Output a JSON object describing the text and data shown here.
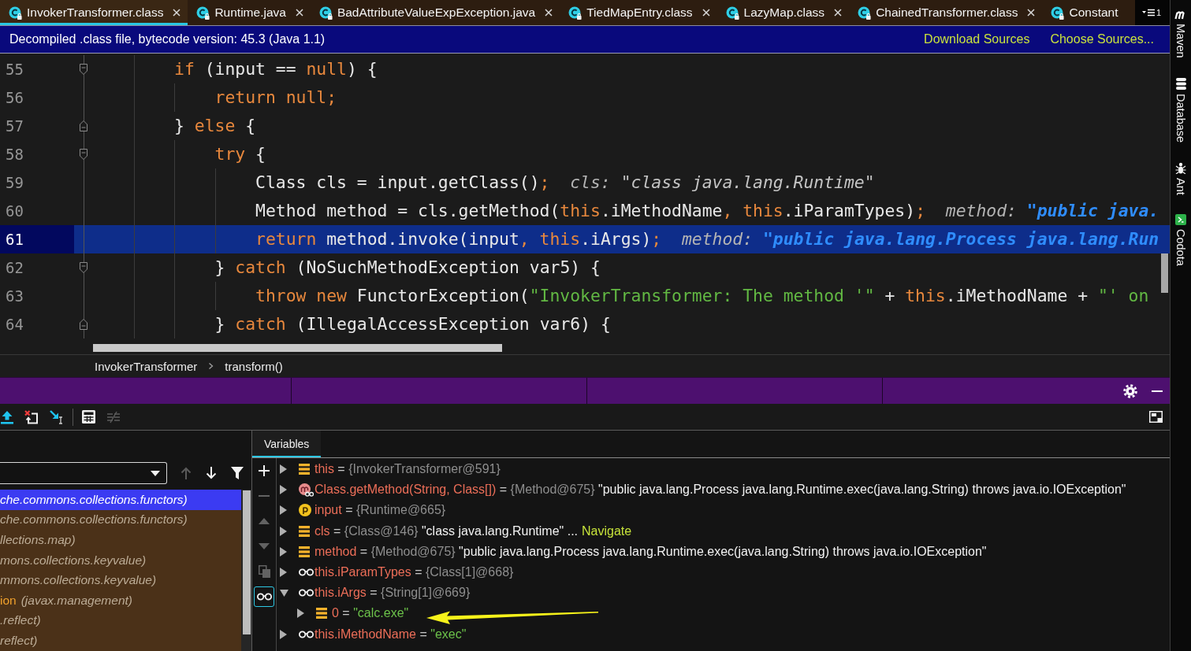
{
  "tabs": [
    {
      "label": "InvokerTransformer.class",
      "selected": true,
      "closable": true
    },
    {
      "label": "Runtime.java",
      "selected": false,
      "closable": true
    },
    {
      "label": "BadAttributeValueExpException.java",
      "selected": false,
      "closable": true
    },
    {
      "label": "TiedMapEntry.class",
      "selected": false,
      "closable": true
    },
    {
      "label": "LazyMap.class",
      "selected": false,
      "closable": true
    },
    {
      "label": "ChainedTransformer.class",
      "selected": false,
      "closable": true
    },
    {
      "label": "Constant",
      "selected": false,
      "closable": false
    }
  ],
  "hidden_tabs": {
    "count": "1"
  },
  "banner": {
    "message": "Decompiled .class file, bytecode version: 45.3 (Java 1.1)",
    "links": [
      "Download Sources",
      "Choose Sources..."
    ]
  },
  "editor": {
    "lines": [
      {
        "number": "55",
        "fold": {
          "kind": "start"
        },
        "current": false,
        "tokens": [
          {
            "kind": "keyword",
            "text": "        if"
          },
          {
            "kind": "plain",
            "text": " (input == "
          },
          {
            "kind": "keyword",
            "text": "null"
          },
          {
            "kind": "plain",
            "text": ") {"
          }
        ]
      },
      {
        "number": "56",
        "current": false,
        "tokens": [
          {
            "kind": "keyword",
            "text": "            return null;"
          }
        ]
      },
      {
        "number": "57",
        "fold": {
          "kind": "end"
        },
        "current": false,
        "tokens": [
          {
            "kind": "plain",
            "text": "        } "
          },
          {
            "kind": "keyword",
            "text": "else"
          },
          {
            "kind": "plain",
            "text": " {"
          }
        ]
      },
      {
        "number": "58",
        "fold": {
          "kind": "start"
        },
        "current": false,
        "tokens": [
          {
            "kind": "keyword",
            "text": "            try"
          },
          {
            "kind": "plain",
            "text": " {"
          }
        ]
      },
      {
        "number": "59",
        "current": false,
        "tokens": [
          {
            "kind": "plain",
            "text": "                Class cls = input.getClass()"
          },
          {
            "kind": "keyword",
            "text": ";"
          }
        ],
        "inline": {
          "name": "cls:",
          "value": "\"class java.lang.Runtime\"",
          "changed": false
        }
      },
      {
        "number": "60",
        "current": false,
        "tokens": [
          {
            "kind": "plain",
            "text": "                Method method = cls.getMethod("
          },
          {
            "kind": "keyword",
            "text": "this"
          },
          {
            "kind": "plain",
            "text": ".iMethodName"
          },
          {
            "kind": "keyword",
            "text": ", this"
          },
          {
            "kind": "plain",
            "text": ".iParamTypes)"
          },
          {
            "kind": "keyword",
            "text": ";"
          }
        ],
        "inline": {
          "name": "method:",
          "value": "\"public java.",
          "changed": true
        }
      },
      {
        "number": "61",
        "current": true,
        "tokens": [
          {
            "kind": "keyword",
            "text": "                return"
          },
          {
            "kind": "plain",
            "text": " method.invoke(input"
          },
          {
            "kind": "keyword",
            "text": ", this"
          },
          {
            "kind": "plain",
            "text": ".iArgs)"
          },
          {
            "kind": "keyword",
            "text": ";"
          }
        ],
        "inline": {
          "name": "method:",
          "value": "\"public java.lang.Process java.lang.Run",
          "changed": true
        }
      },
      {
        "number": "62",
        "fold": {
          "kind": "start"
        },
        "current": false,
        "tokens": [
          {
            "kind": "plain",
            "text": "            } "
          },
          {
            "kind": "keyword",
            "text": "catch"
          },
          {
            "kind": "plain",
            "text": " (NoSuchMethodException var5) {"
          }
        ]
      },
      {
        "number": "63",
        "current": false,
        "tokens": [
          {
            "kind": "keyword",
            "text": "                throw new"
          },
          {
            "kind": "plain",
            "text": " FunctorException("
          },
          {
            "kind": "string",
            "text": "\"InvokerTransformer: The method '\""
          },
          {
            "kind": "plain",
            "text": " + "
          },
          {
            "kind": "keyword",
            "text": "this"
          },
          {
            "kind": "plain",
            "text": ".iMethodName + "
          },
          {
            "kind": "string",
            "text": "\"' on"
          }
        ]
      },
      {
        "number": "64",
        "fold": {
          "kind": "end"
        },
        "current": false,
        "tokens": [
          {
            "kind": "plain",
            "text": "            } "
          },
          {
            "kind": "keyword",
            "text": "catch"
          },
          {
            "kind": "plain",
            "text": " (IllegalAccessException var6) {"
          }
        ]
      }
    ]
  },
  "breadcrumbs": [
    "InvokerTransformer",
    "transform()"
  ],
  "debugger": {
    "toolbar": {
      "groups": [
        [
          {
            "kind": "step-out",
            "disabled": false
          },
          {
            "kind": "drop-frame",
            "disabled": false
          },
          {
            "kind": "run-to-cursor",
            "disabled": false
          }
        ],
        [
          {
            "kind": "evaluate",
            "disabled": false
          },
          {
            "kind": "trace",
            "disabled": true
          }
        ]
      ]
    },
    "frames": {
      "controls": [
        {
          "kind": "up",
          "disabled": true
        },
        {
          "kind": "down",
          "disabled": false
        },
        {
          "kind": "filter",
          "disabled": false
        }
      ],
      "items": [
        {
          "package": "che.commons.collections.functors)",
          "selected": true
        },
        {
          "package": "che.commons.collections.functors)",
          "selected": false
        },
        {
          "package": "llections.map)",
          "selected": false
        },
        {
          "package": "mons.collections.keyvalue)",
          "selected": false
        },
        {
          "package": "mmons.collections.keyvalue)",
          "selected": false
        },
        {
          "method": "ion",
          "package": "(javax.management)",
          "selected": false
        },
        {
          "package": ".reflect)",
          "selected": false
        },
        {
          "package": "reflect)",
          "selected": false
        }
      ]
    },
    "variables": {
      "tab": {
        "label": "Variables",
        "selected": true
      },
      "tools": [
        {
          "kind": "add",
          "disabled": false,
          "selected": false
        },
        {
          "kind": "remove",
          "disabled": true,
          "selected": false
        },
        {
          "kind": "move-up",
          "disabled": true,
          "selected": false
        },
        {
          "kind": "move-down",
          "disabled": true,
          "selected": false
        },
        {
          "kind": "copy",
          "disabled": true,
          "selected": false
        },
        {
          "kind": "watches",
          "disabled": false,
          "selected": true
        }
      ],
      "items": [
        {
          "kind": "local",
          "name": "this",
          "operator": "=",
          "ref": "{InvokerTransformer@591}",
          "expanded": false
        },
        {
          "kind": "method-return",
          "name": "Class.getMethod(String, Class[])",
          "operator": "=",
          "ref": "{Method@675}",
          "summary": "\"public java.lang.Process java.lang.Runtime.exec(java.lang.String) throws java.io.IOException\"",
          "expanded": false
        },
        {
          "kind": "parameter",
          "name": "input",
          "operator": "=",
          "ref": "{Runtime@665}",
          "expanded": false
        },
        {
          "kind": "local",
          "name": "cls",
          "operator": "=",
          "ref": "{Class@146}",
          "summary": "\"class java.lang.Runtime\" ...",
          "link": "Navigate",
          "expanded": false
        },
        {
          "kind": "local",
          "name": "method",
          "operator": "=",
          "ref": "{Method@675}",
          "summary": "\"public java.lang.Process java.lang.Runtime.exec(java.lang.String) throws java.io.IOException\"",
          "expanded": false
        },
        {
          "kind": "watch",
          "name": "this.iParamTypes",
          "operator": "=",
          "ref": "{Class[1]@668}",
          "expanded": false
        },
        {
          "kind": "watch",
          "name": "this.iArgs",
          "operator": "=",
          "ref": "{String[1]@669}",
          "expanded": true,
          "children": [
            {
              "kind": "local",
              "name": "0",
              "operator": "=",
              "string": "\"calc.exe\"",
              "expanded": false
            }
          ]
        },
        {
          "kind": "watch",
          "name": "this.iMethodName",
          "operator": "=",
          "string": "\"exec\"",
          "expanded": false
        }
      ]
    }
  },
  "side_tools": [
    {
      "kind": "maven",
      "label": "Maven"
    },
    {
      "kind": "database",
      "label": "Database"
    },
    {
      "kind": "ant",
      "label": "Ant"
    },
    {
      "kind": "codota",
      "label": "Codota"
    }
  ]
}
